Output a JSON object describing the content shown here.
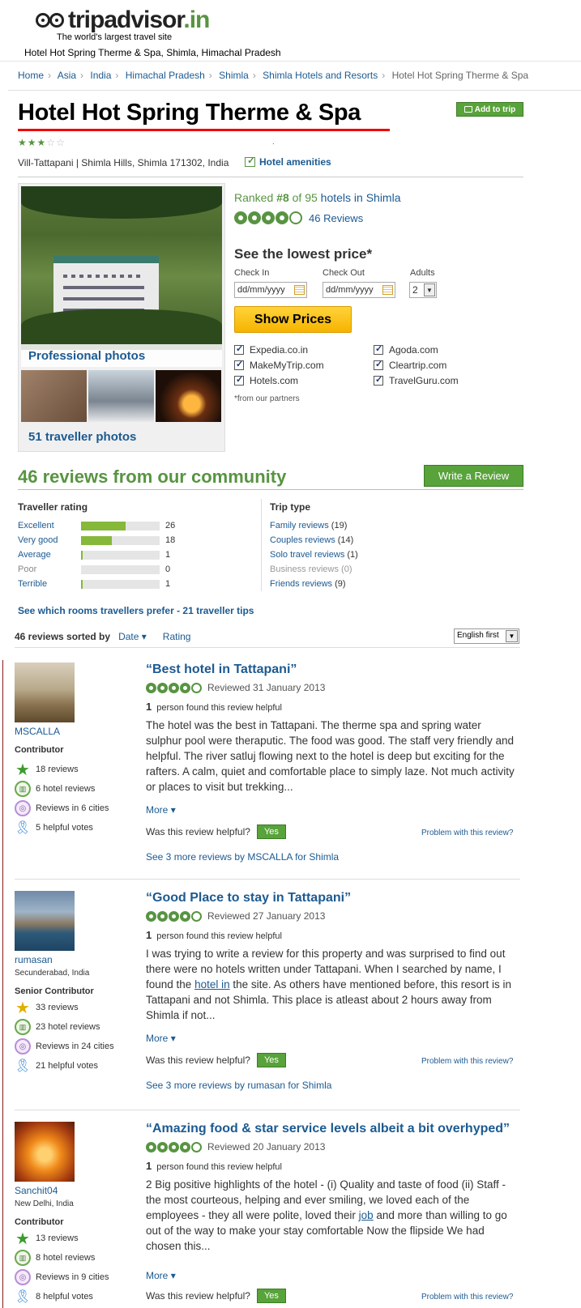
{
  "header": {
    "logo_main": "tripadvisor",
    "logo_tld": ".in",
    "tagline": "The world's largest travel site",
    "subtitle": "Hotel Hot Spring Therme & Spa, Shimla, Himachal Pradesh"
  },
  "breadcrumb": [
    "Home",
    "Asia",
    "India",
    "Himachal Pradesh",
    "Shimla",
    "Shimla Hotels and Resorts",
    "Hotel Hot Spring Therme & Spa"
  ],
  "hotel": {
    "name": "Hotel Hot Spring Therme & Spa",
    "star_class": 3,
    "address": "Vill-Tattapani | Shimla Hills, Shimla 171302, India",
    "amenities_link": "Hotel amenities",
    "add_to_trip": "Add to trip",
    "dot": "."
  },
  "photos": {
    "professional_label": "Professional photos",
    "traveller_label": "51 traveller photos"
  },
  "ranking": {
    "ranked_prefix": "Ranked ",
    "rank": "#8",
    "of_text": " of 95 ",
    "category_link": "hotels in Shimla",
    "bubbles": 4,
    "reviews_link": "46 Reviews"
  },
  "pricing": {
    "heading": "See the lowest price*",
    "checkin_label": "Check In",
    "checkout_label": "Check Out",
    "adults_label": "Adults",
    "checkin_placeholder": "dd/mm/yyyy",
    "checkout_placeholder": "dd/mm/yyyy",
    "adults_value": "2",
    "show_prices": "Show Prices",
    "partners": [
      "Expedia.co.in",
      "MakeMyTrip.com",
      "Hotels.com",
      "Agoda.com",
      "Cleartrip.com",
      "TravelGuru.com"
    ],
    "partners_note": "*from our partners"
  },
  "reviews_summary": {
    "heading": "46 reviews from our community",
    "write_review": "Write a Review",
    "traveller_rating_title": "Traveller rating",
    "ratings": [
      {
        "label": "Excellent",
        "count": "26",
        "fraction": 0.565
      },
      {
        "label": "Very good",
        "count": "18",
        "fraction": 0.39
      },
      {
        "label": "Average",
        "count": "1",
        "fraction": 0.022
      },
      {
        "label": "Poor",
        "count": "0",
        "fraction": 0
      },
      {
        "label": "Terrible",
        "count": "1",
        "fraction": 0.022
      }
    ],
    "trip_type_title": "Trip type",
    "trip_types": [
      {
        "label": "Family reviews",
        "count": "(19)"
      },
      {
        "label": "Couples reviews",
        "count": "(14)"
      },
      {
        "label": "Solo travel reviews",
        "count": "(1)"
      },
      {
        "label": "Business reviews",
        "count": "(0)"
      },
      {
        "label": "Friends reviews",
        "count": "(9)"
      }
    ],
    "tips_link": "See which rooms travellers prefer - 21 traveller tips"
  },
  "sort": {
    "label": "46 reviews sorted by",
    "date": "Date",
    "rating": "Rating",
    "language": "English first"
  },
  "reviews": [
    {
      "username": "MSCALLA",
      "location": "",
      "level": "Contributor",
      "badges": [
        "18 reviews",
        "6 hotel reviews",
        "Reviews in 6 cities",
        "5 helpful votes"
      ],
      "title": "“Best hotel in Tattapani”",
      "reviewed": "Reviewed 31 January 2013",
      "helpful_num": "1",
      "helpful_text": "person found this review helpful",
      "body_pre": "The hotel was the best in Tattapani. The therme spa and spring water sulphur pool were theraputic. The food was good. The staff very friendly and helpful. The river satluj flowing next to the hotel is deep but exciting for the rafters. A calm, quiet and comfortable place to simply laze. Not much activity or places to visit but trekking...",
      "body_link": "",
      "body_post": "",
      "more": "More",
      "helpful_q": "Was this review helpful?",
      "yes": "Yes",
      "problem": "Problem with this review?",
      "see_more": "See 3 more reviews by MSCALLA for Shimla"
    },
    {
      "username": "rumasan",
      "location": "Secunderabad, India",
      "level": "Senior Contributor",
      "badges": [
        "33 reviews",
        "23 hotel reviews",
        "Reviews in 24 cities",
        "21 helpful votes"
      ],
      "title": "“Good Place to stay in Tattapani”",
      "reviewed": "Reviewed 27 January 2013",
      "helpful_num": "1",
      "helpful_text": "person found this review helpful",
      "body_pre": "I was trying to write a review for this property and was surprised to find out there were no hotels written under Tattapani. When I searched by name, I found the ",
      "body_link": "hotel in",
      "body_post": " the site. As others have mentioned before, this resort is in Tattapani and not Shimla. This place is atleast about 2 hours away from Shimla if not...",
      "more": "More",
      "helpful_q": "Was this review helpful?",
      "yes": "Yes",
      "problem": "Problem with this review?",
      "see_more": "See 3 more reviews by rumasan for Shimla"
    },
    {
      "username": "Sanchit04",
      "location": "New Delhi, India",
      "level": "Contributor",
      "badges": [
        "13 reviews",
        "8 hotel reviews",
        "Reviews in 9 cities",
        "8 helpful votes"
      ],
      "title": "“Amazing food & star service levels albeit a bit overhyped”",
      "reviewed": "Reviewed 20 January 2013",
      "helpful_num": "1",
      "helpful_text": "person found this review helpful",
      "body_pre": "2 Big positive highlights of the hotel - (i) Quality and taste of food (ii) Staff - the most courteous, helping and ever smiling, we loved each of the employees - they all were polite, loved their ",
      "body_link": "job",
      "body_post": " and more than willing to go out of the way to make your stay comfortable Now the flipside We had chosen this...",
      "more": "More",
      "helpful_q": "Was this review helpful?",
      "yes": "Yes",
      "problem": "Problem with this review?",
      "see_more": ""
    }
  ],
  "colors": {
    "brand_green": "#589442",
    "link_blue": "#1c5a91",
    "title_underline": "#e00000"
  }
}
